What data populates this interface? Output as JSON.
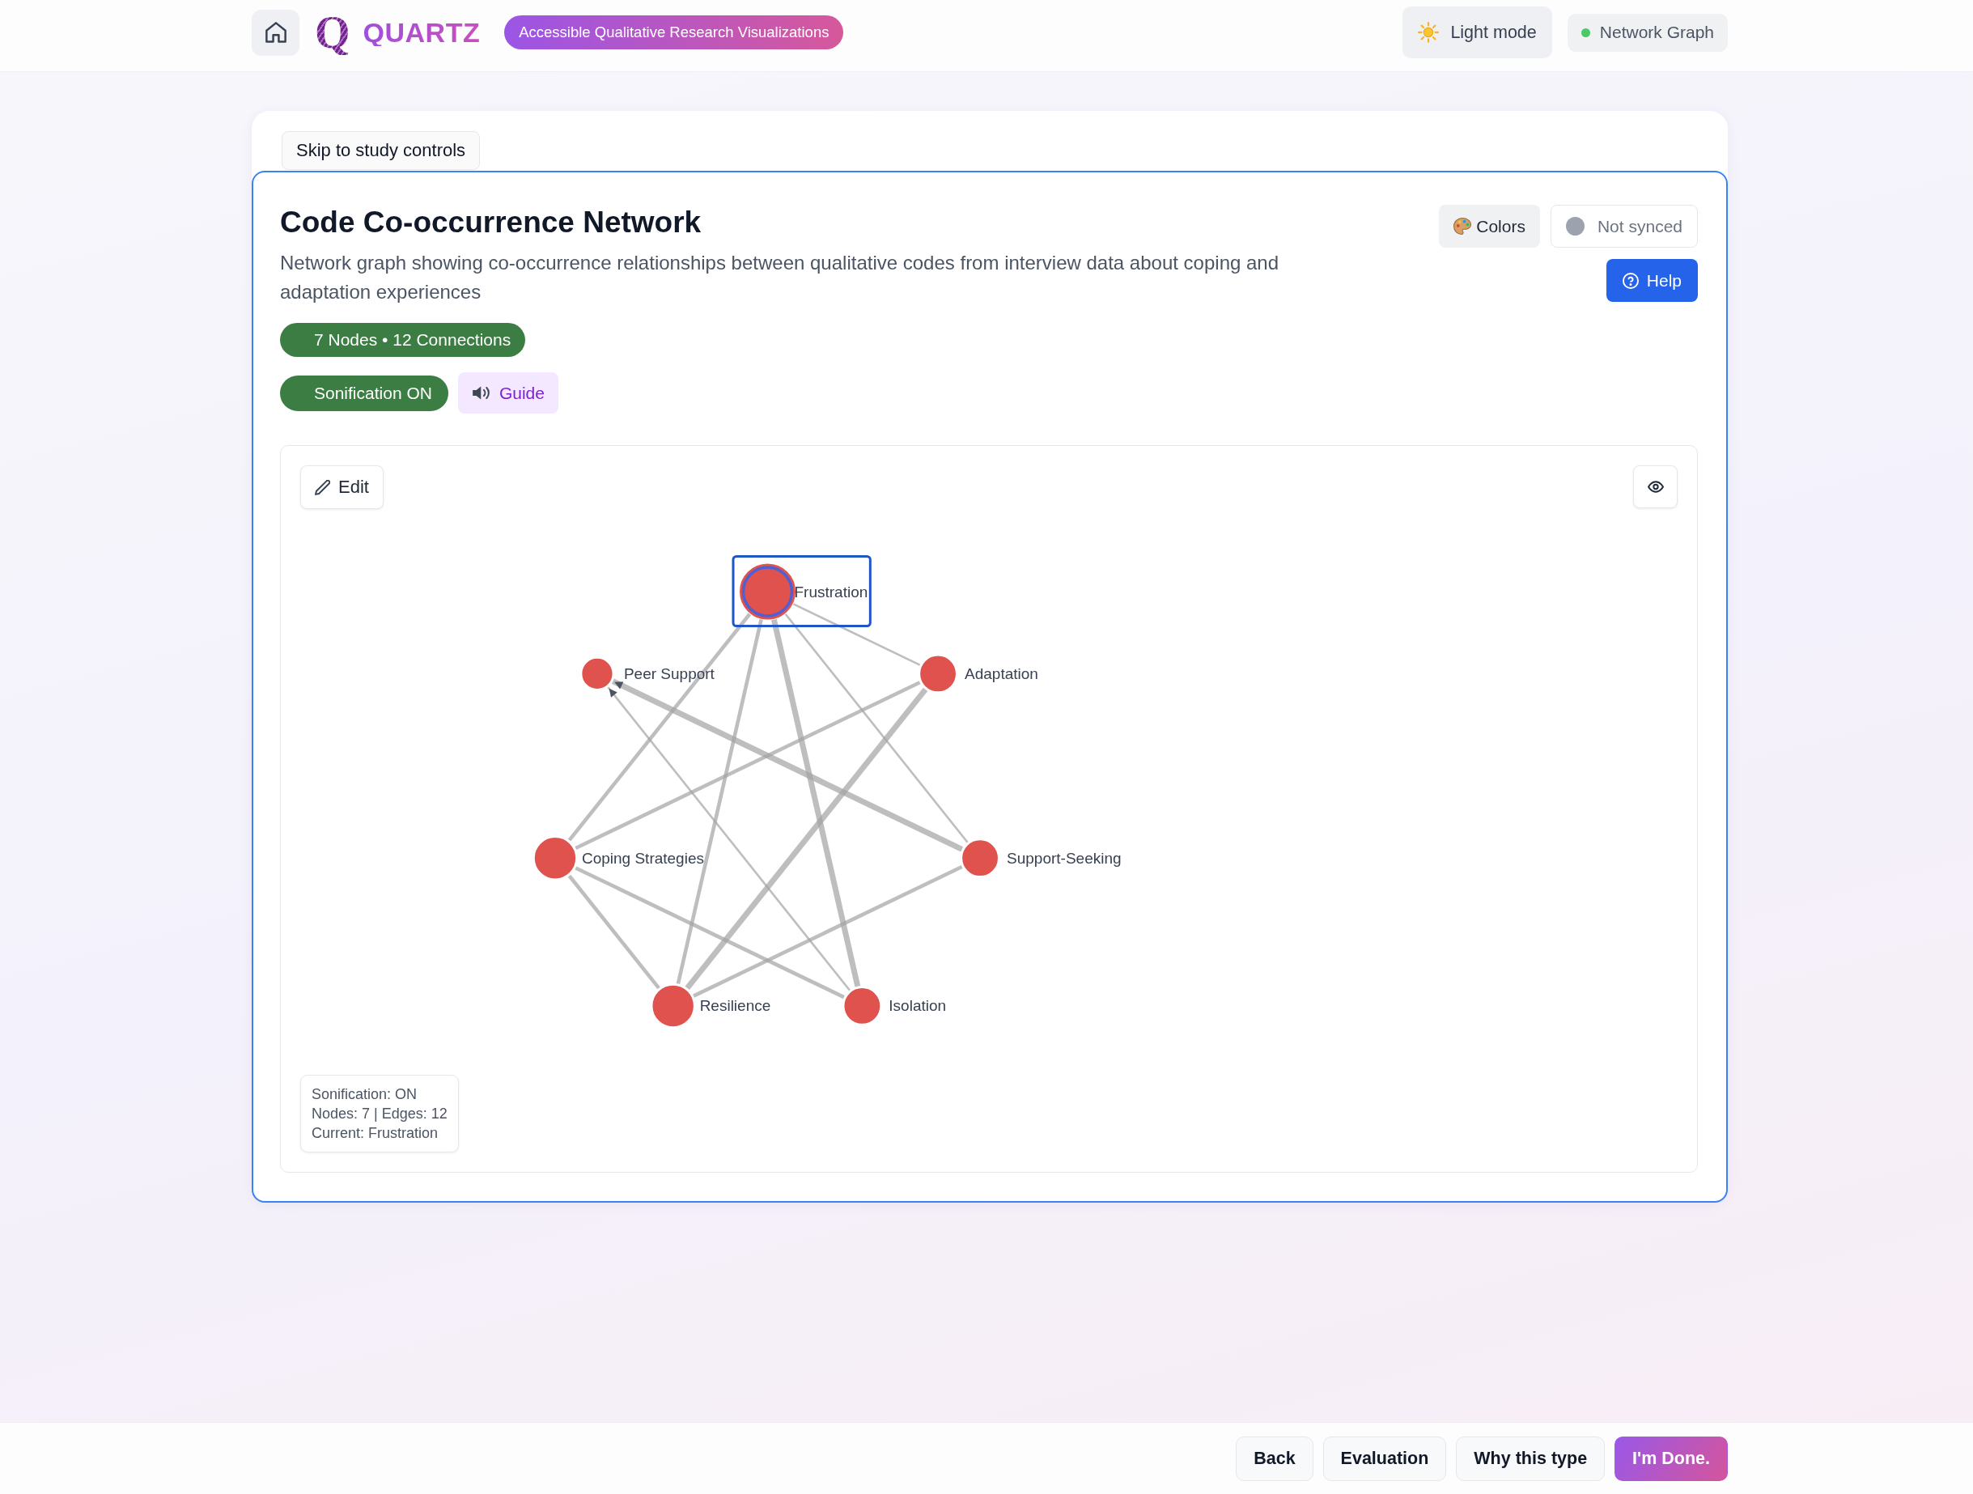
{
  "header": {
    "logo_mark": "Q",
    "brand": "QUARTZ",
    "tagline": "Accessible Qualitative Research Visualizations",
    "theme_button": "Light mode",
    "view_indicator": "Network Graph"
  },
  "skip_link": "Skip to study controls",
  "visualization": {
    "title": "Code Co-occurrence Network",
    "description": "Network graph showing co-occurrence relationships between qualitative codes from interview data about coping and adaptation experiences",
    "stats_badge": "7 Nodes • 12 Connections",
    "sonification": {
      "label": "Sonification ON",
      "on": true
    },
    "guide_button": "Guide",
    "colors_button": "Colors",
    "sync_status": {
      "label": "Not synced",
      "synced": false
    },
    "help_button": "Help",
    "graph": {
      "edit_button": "Edit",
      "nodes": [
        {
          "label": "Frustration",
          "selected": true
        },
        {
          "label": "Peer Support",
          "selected": false
        },
        {
          "label": "Adaptation",
          "selected": false
        },
        {
          "label": "Coping Strategies",
          "selected": false
        },
        {
          "label": "Support-Seeking",
          "selected": false
        },
        {
          "label": "Resilience",
          "selected": false
        },
        {
          "label": "Isolation",
          "selected": false
        }
      ],
      "edges": [
        {
          "kind": "thin",
          "arrow": false
        },
        {
          "kind": "medium",
          "arrow": false
        },
        {
          "kind": "medium",
          "arrow": false
        },
        {
          "kind": "thick",
          "arrow": false
        },
        {
          "kind": "thin",
          "arrow": false
        },
        {
          "kind": "thick",
          "arrow": true
        },
        {
          "kind": "thin",
          "arrow": true
        },
        {
          "kind": "medium",
          "arrow": false
        },
        {
          "kind": "thick",
          "arrow": false
        },
        {
          "kind": "medium",
          "arrow": false
        },
        {
          "kind": "medium",
          "arrow": false
        },
        {
          "kind": "medium",
          "arrow": false
        }
      ],
      "info": [
        "Sonification: ON",
        "Nodes: 7 | Edges: 12",
        "Current: Frustration"
      ]
    }
  },
  "footer": {
    "buttons": [
      {
        "label": "Back",
        "kind": "secondary"
      },
      {
        "label": "Evaluation",
        "kind": "secondary"
      },
      {
        "label": "Why this type",
        "kind": "secondary"
      },
      {
        "label": "I'm Done.",
        "kind": "primary"
      }
    ]
  }
}
